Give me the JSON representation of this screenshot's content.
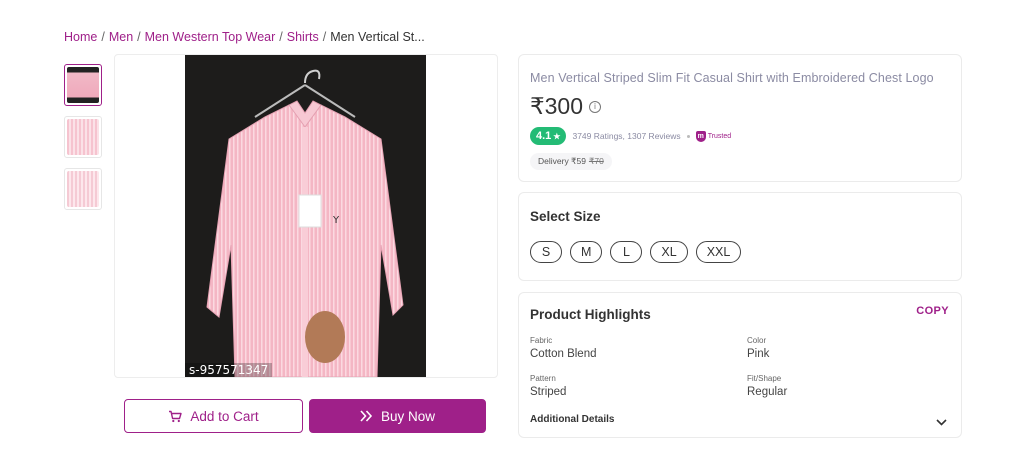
{
  "breadcrumb": {
    "items": [
      "Home",
      "Men",
      "Men Western Top Wear",
      "Shirts"
    ],
    "current": "Men Vertical St...",
    "separator": "/"
  },
  "gallery": {
    "thumbnails": [
      "thumbnail-1",
      "thumbnail-2",
      "thumbnail-3"
    ],
    "sku_text": "s-957571347"
  },
  "actions": {
    "add_to_cart": "Add to Cart",
    "buy_now": "Buy Now"
  },
  "product": {
    "title": "Men Vertical Striped Slim Fit Casual Shirt with Embroidered Chest Logo",
    "price": "₹300",
    "rating": "4.1",
    "rating_star": "★",
    "ratings_reviews": "3749 Ratings, 1307 Reviews",
    "trusted_label": "Trusted",
    "delivery_label": "Delivery ₹59",
    "delivery_original": "₹70"
  },
  "sizes": {
    "title": "Select Size",
    "options": [
      "S",
      "M",
      "L",
      "XL",
      "XXL"
    ]
  },
  "highlights": {
    "title": "Product Highlights",
    "copy_label": "COPY",
    "attributes": [
      {
        "key": "Fabric",
        "value": "Cotton Blend"
      },
      {
        "key": "Color",
        "value": "Pink"
      },
      {
        "key": "Pattern",
        "value": "Striped"
      },
      {
        "key": "Fit/Shape",
        "value": "Regular"
      }
    ],
    "additional_details": "Additional Details"
  },
  "colors": {
    "accent": "#9f2089",
    "rating_green": "#23bb75"
  }
}
